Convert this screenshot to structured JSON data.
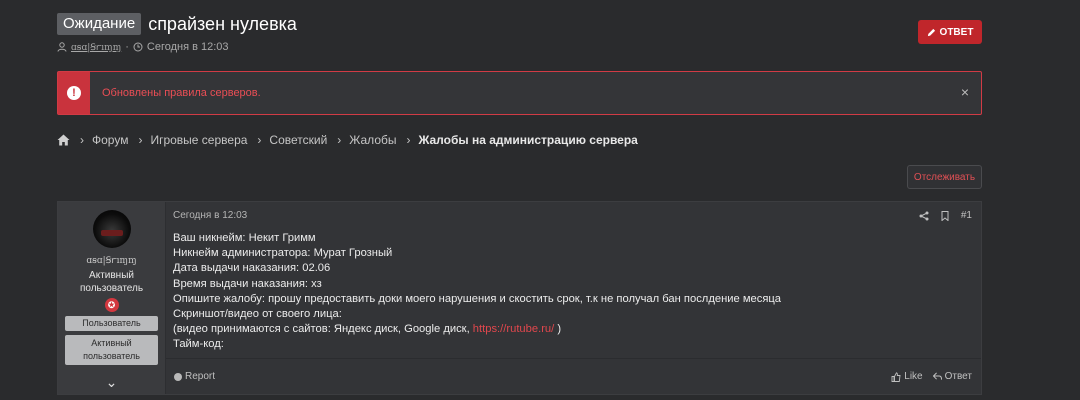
{
  "thread": {
    "prefix": "Ожидание",
    "title": "спрайзен нулевка",
    "author": "ɑꞩɑ|Ꞩꭈıɱɱ",
    "date_sep": "·",
    "date": "Сегодня в 12:03"
  },
  "reply_button": {
    "label": "ОТВЕТ"
  },
  "notice": {
    "text": "Обновлены правила серверов.",
    "close": "×"
  },
  "breadcrumb": {
    "items": [
      "Форум",
      "Игровые сервера",
      "Советский",
      "Жалобы"
    ],
    "current": "Жалобы на администрацию сервера",
    "separator": "›"
  },
  "watch_button": {
    "label": "Отслеживать"
  },
  "post": {
    "user": {
      "name": "ɑꞩɑ|Ꞩꭈıɱɱ",
      "title_line1": "Активный",
      "title_line2": "пользователь",
      "badge": "✪",
      "banners": [
        "Пользователь",
        "Активный пользователь"
      ],
      "expand": "⌄"
    },
    "date": "Сегодня в 12:03",
    "number": "#1",
    "lines": {
      "l1": "Ваш никнейм: Некит Гримм",
      "l2": "Никнейм администратора: Мурат Грозный",
      "l3": "Дата выдачи наказания: 02.06",
      "l4": "Время выдачи наказания: хз",
      "l5": "Опишите жалобу: прошу предоставить доки моего нарушения и скостить срок, т.к не получал бан послдение месяца",
      "l6": "Скриншот/видео от своего лица:",
      "l7_prefix": "(видео принимаются с сайтов: Яндекс диск, Google диск,",
      "l7_link": "https://rutube.ru/",
      "l7_suffix": ")",
      "l8": "Тайм-код:"
    },
    "footer": {
      "report": "Report",
      "like": "Like",
      "reply": "Ответ"
    }
  },
  "colors": {
    "accent": "#c0262b",
    "notice_text": "#ea4e55",
    "background": "#2a2b2d"
  },
  "icons": [
    "user-icon",
    "clock-icon",
    "pencil-icon",
    "alert-icon",
    "close-icon",
    "home-icon",
    "share-icon",
    "bookmark-icon",
    "report-icon",
    "like-icon",
    "reply-icon",
    "chevron-down-icon"
  ]
}
